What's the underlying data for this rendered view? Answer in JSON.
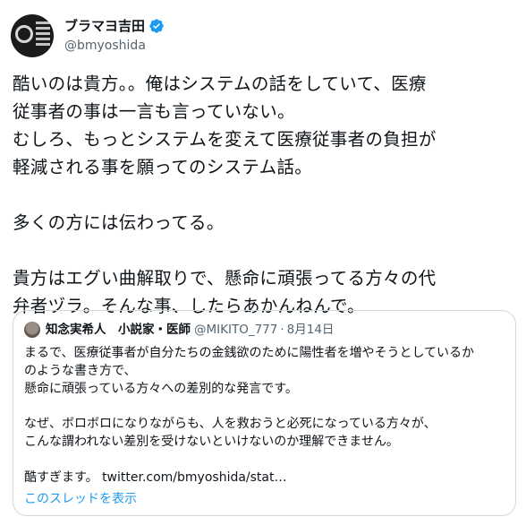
{
  "author": {
    "display_name": "ブラマヨ吉田",
    "handle": "@bmyoshida",
    "avatar_icon": "profile-avatar",
    "verified_icon": "verified-badge-icon"
  },
  "tweet": {
    "text": "酷いのは貴方。。俺はシステムの話をしていて、医療\n従事者の事は一言も言っていない。\nむしろ、もっとシステムを変えて医療従事者の負担が\n軽減される事を願ってのシステム話。\n\n多くの方には伝わってる。\n\n貴方はエグい曲解取りで、懸命に頑張ってる方々の代\n弁者ヅラ。そんな事、したらあかんねんで。"
  },
  "quoted_tweet": {
    "display_name": "知念実希人　小説家・医師",
    "handle": "@MIKITO_777",
    "separator": "·",
    "date": "8月14日",
    "text": "まるで、医療従事者が自分たちの金銭欲のために陽性者を増やそうとしているか\nのような書き方で、\n懸命に頑張っている方々への差別的な発言です。\n\nなぜ、ボロボロになりながらも、人を救おうと必死になっている方々が、\nこんな謂われない差別を受けないといけないのか理解できません。\n\n酷すぎます。 ",
    "link": "twitter.com/bmyoshida/stat…",
    "show_thread": "このスレッドを表示"
  },
  "colors": {
    "text": "#0f1419",
    "secondary": "#536471",
    "accent": "#1d9bf0",
    "border": "#cfd9de"
  }
}
